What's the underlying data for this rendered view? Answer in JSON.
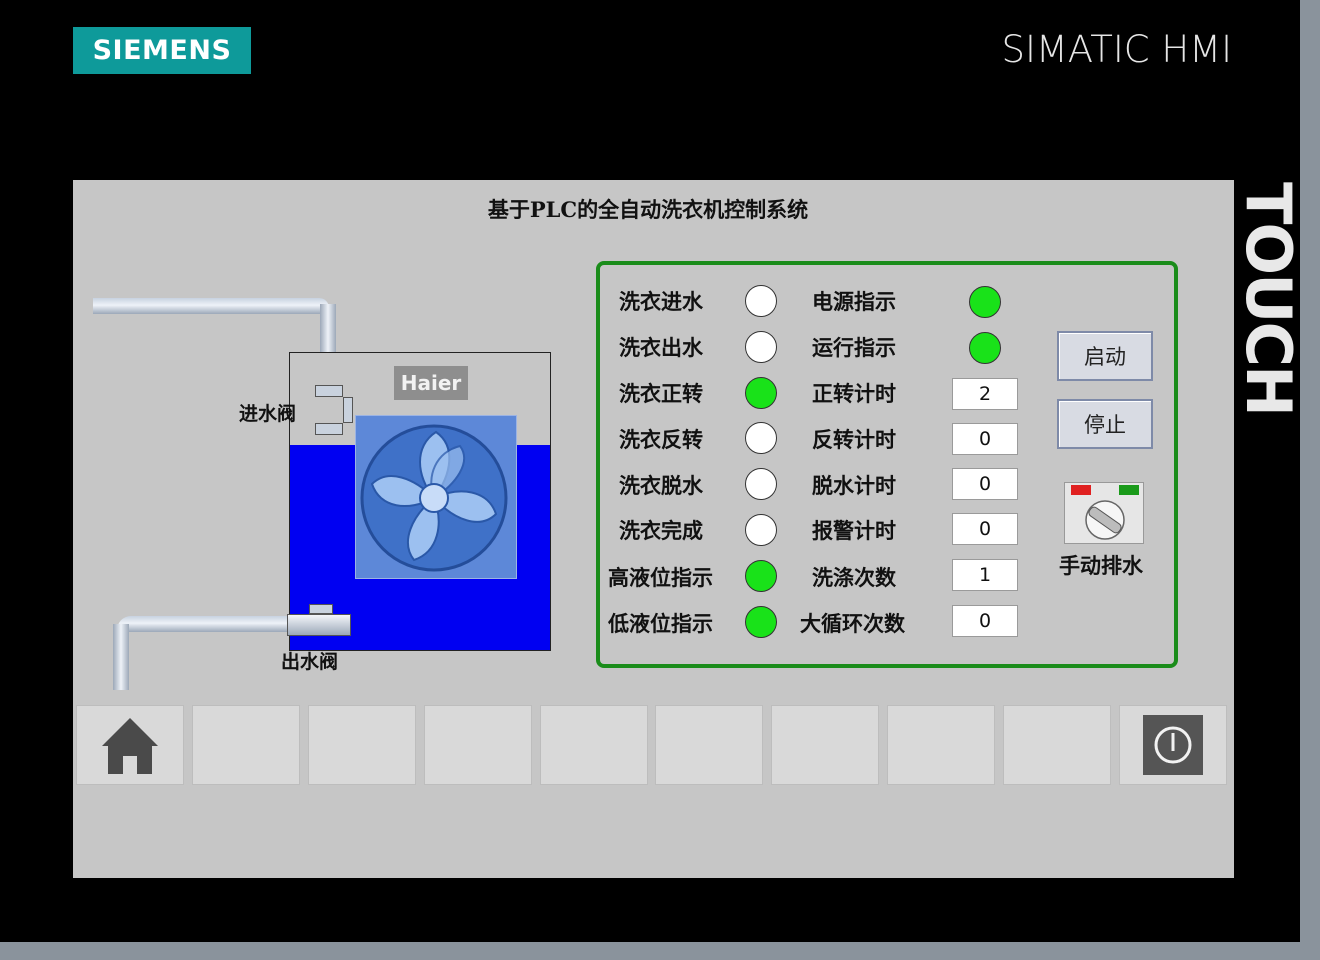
{
  "device": {
    "brand_logo": "SIEMENS",
    "model_title": "SIMATIC HMI",
    "side_label": "TOUCH"
  },
  "screen": {
    "title": "基于PLC的全自动洗衣机控制系统",
    "machine": {
      "brand": "Haier",
      "inlet_valve_label": "进水阀",
      "outlet_valve_label": "出水阀"
    },
    "status_lamps": [
      {
        "label": "洗衣进水",
        "state": "off"
      },
      {
        "label": "洗衣出水",
        "state": "off"
      },
      {
        "label": "洗衣正转",
        "state": "on"
      },
      {
        "label": "洗衣反转",
        "state": "off"
      },
      {
        "label": "洗衣脱水",
        "state": "off"
      },
      {
        "label": "洗衣完成",
        "state": "off"
      },
      {
        "label": "高液位指示",
        "state": "on"
      },
      {
        "label": "低液位指示",
        "state": "on"
      }
    ],
    "indicators": [
      {
        "label": "电源指示",
        "state": "on"
      },
      {
        "label": "运行指示",
        "state": "on"
      }
    ],
    "values": [
      {
        "label": "正转计时",
        "value": "2"
      },
      {
        "label": "反转计时",
        "value": "0"
      },
      {
        "label": "脱水计时",
        "value": "0"
      },
      {
        "label": "报警计时",
        "value": "0"
      },
      {
        "label": "洗涤次数",
        "value": "1"
      },
      {
        "label": "大循环次数",
        "value": "0"
      }
    ],
    "buttons": {
      "start": "启动",
      "stop": "停止",
      "manual_drain": "手动排水"
    },
    "colors": {
      "lamp_on": "#19e219",
      "lamp_off": "#ffffff",
      "panel_border": "#1a8c1a",
      "water": "#0000f2",
      "logo_bg": "#0e9a9a"
    }
  },
  "function_keys": [
    {
      "icon": "home-icon"
    },
    {
      "icon": ""
    },
    {
      "icon": ""
    },
    {
      "icon": ""
    },
    {
      "icon": ""
    },
    {
      "icon": ""
    },
    {
      "icon": ""
    },
    {
      "icon": ""
    },
    {
      "icon": ""
    },
    {
      "icon": "power-icon"
    }
  ]
}
